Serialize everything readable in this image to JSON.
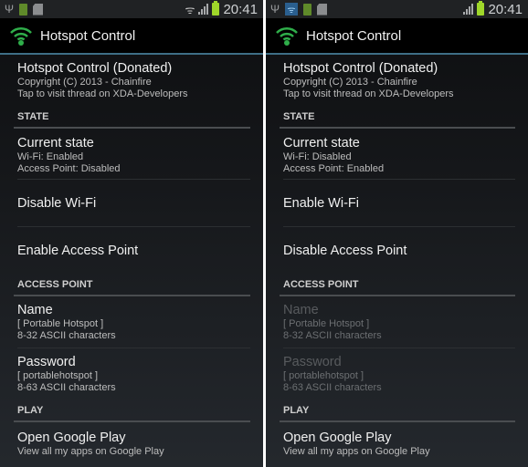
{
  "screens": [
    {
      "status_bar": {
        "time": "20:41",
        "icons": [
          "usb-icon",
          "battery-full-icon",
          "sd-card-icon",
          "wifi-tether-icon",
          "signal-icon",
          "battery-icon"
        ]
      },
      "app_title": "Hotspot Control",
      "about": {
        "title": "Hotspot Control (Donated)",
        "line1": "Copyright (C) 2013 - Chainfire",
        "line2": "Tap to visit thread on XDA-Developers"
      },
      "state_header": "STATE",
      "current_state": {
        "title": "Current state",
        "wifi": "Wi-Fi: Enabled",
        "ap": "Access Point: Disabled"
      },
      "wifi_toggle": "Disable Wi-Fi",
      "ap_toggle": "Enable Access Point",
      "ap_header": "ACCESS POINT",
      "name": {
        "title": "Name",
        "value": "[ Portable Hotspot ]",
        "hint": "8-32 ASCII characters",
        "enabled": true
      },
      "password": {
        "title": "Password",
        "value": "[ portablehotspot ]",
        "hint": "8-63 ASCII characters",
        "enabled": true
      },
      "play_header": "PLAY",
      "play": {
        "title": "Open Google Play",
        "sub": "View all my apps on Google Play"
      }
    },
    {
      "status_bar": {
        "time": "20:41",
        "icons": [
          "usb-icon",
          "wifi-icon",
          "battery-full-icon",
          "sd-card-icon",
          "signal-icon",
          "battery-icon"
        ]
      },
      "app_title": "Hotspot Control",
      "about": {
        "title": "Hotspot Control (Donated)",
        "line1": "Copyright (C) 2013 - Chainfire",
        "line2": "Tap to visit thread on XDA-Developers"
      },
      "state_header": "STATE",
      "current_state": {
        "title": "Current state",
        "wifi": "Wi-Fi: Disabled",
        "ap": "Access Point: Enabled"
      },
      "wifi_toggle": "Enable Wi-Fi",
      "ap_toggle": "Disable Access Point",
      "ap_header": "ACCESS POINT",
      "name": {
        "title": "Name",
        "value": "[ Portable Hotspot ]",
        "hint": "8-32 ASCII characters",
        "enabled": false
      },
      "password": {
        "title": "Password",
        "value": "[ portablehotspot ]",
        "hint": "8-63 ASCII characters",
        "enabled": false
      },
      "play_header": "PLAY",
      "play": {
        "title": "Open Google Play",
        "sub": "View all my apps on Google Play"
      }
    }
  ],
  "colors": {
    "accent_line": "#3e6f86",
    "app_icon": "#2fae4a",
    "battery": "#9fd72a"
  }
}
